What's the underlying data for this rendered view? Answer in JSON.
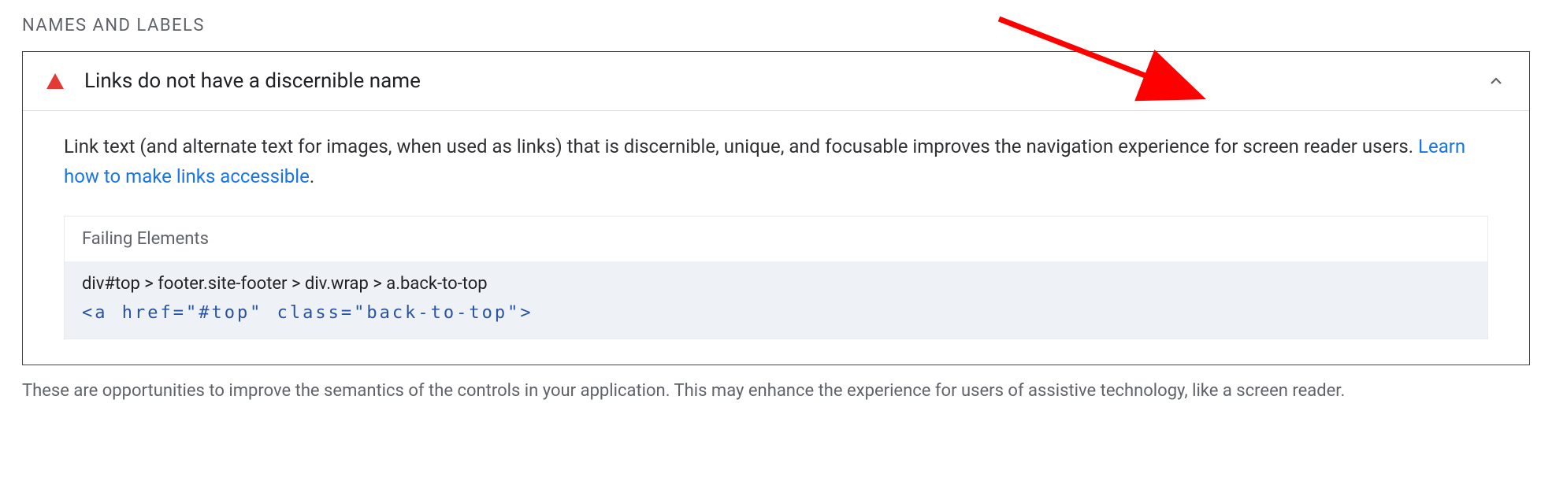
{
  "section": {
    "title": "NAMES AND LABELS"
  },
  "audit": {
    "title": "Links do not have a discernible name",
    "description_prefix": "Link text (and alternate text for images, when used as links) that is discernible, unique, and focusable improves the navigation experience for screen reader users. ",
    "learn_more_label": "Learn how to make links accessible",
    "failing_header": "Failing Elements",
    "failing_selector": "div#top > footer.site-footer > div.wrap > a.back-to-top",
    "failing_code": "<a href=\"#top\" class=\"back-to-top\">"
  },
  "footer_note": "These are opportunities to improve the semantics of the controls in your application. This may enhance the experience for users of assistive technology, like a screen reader."
}
